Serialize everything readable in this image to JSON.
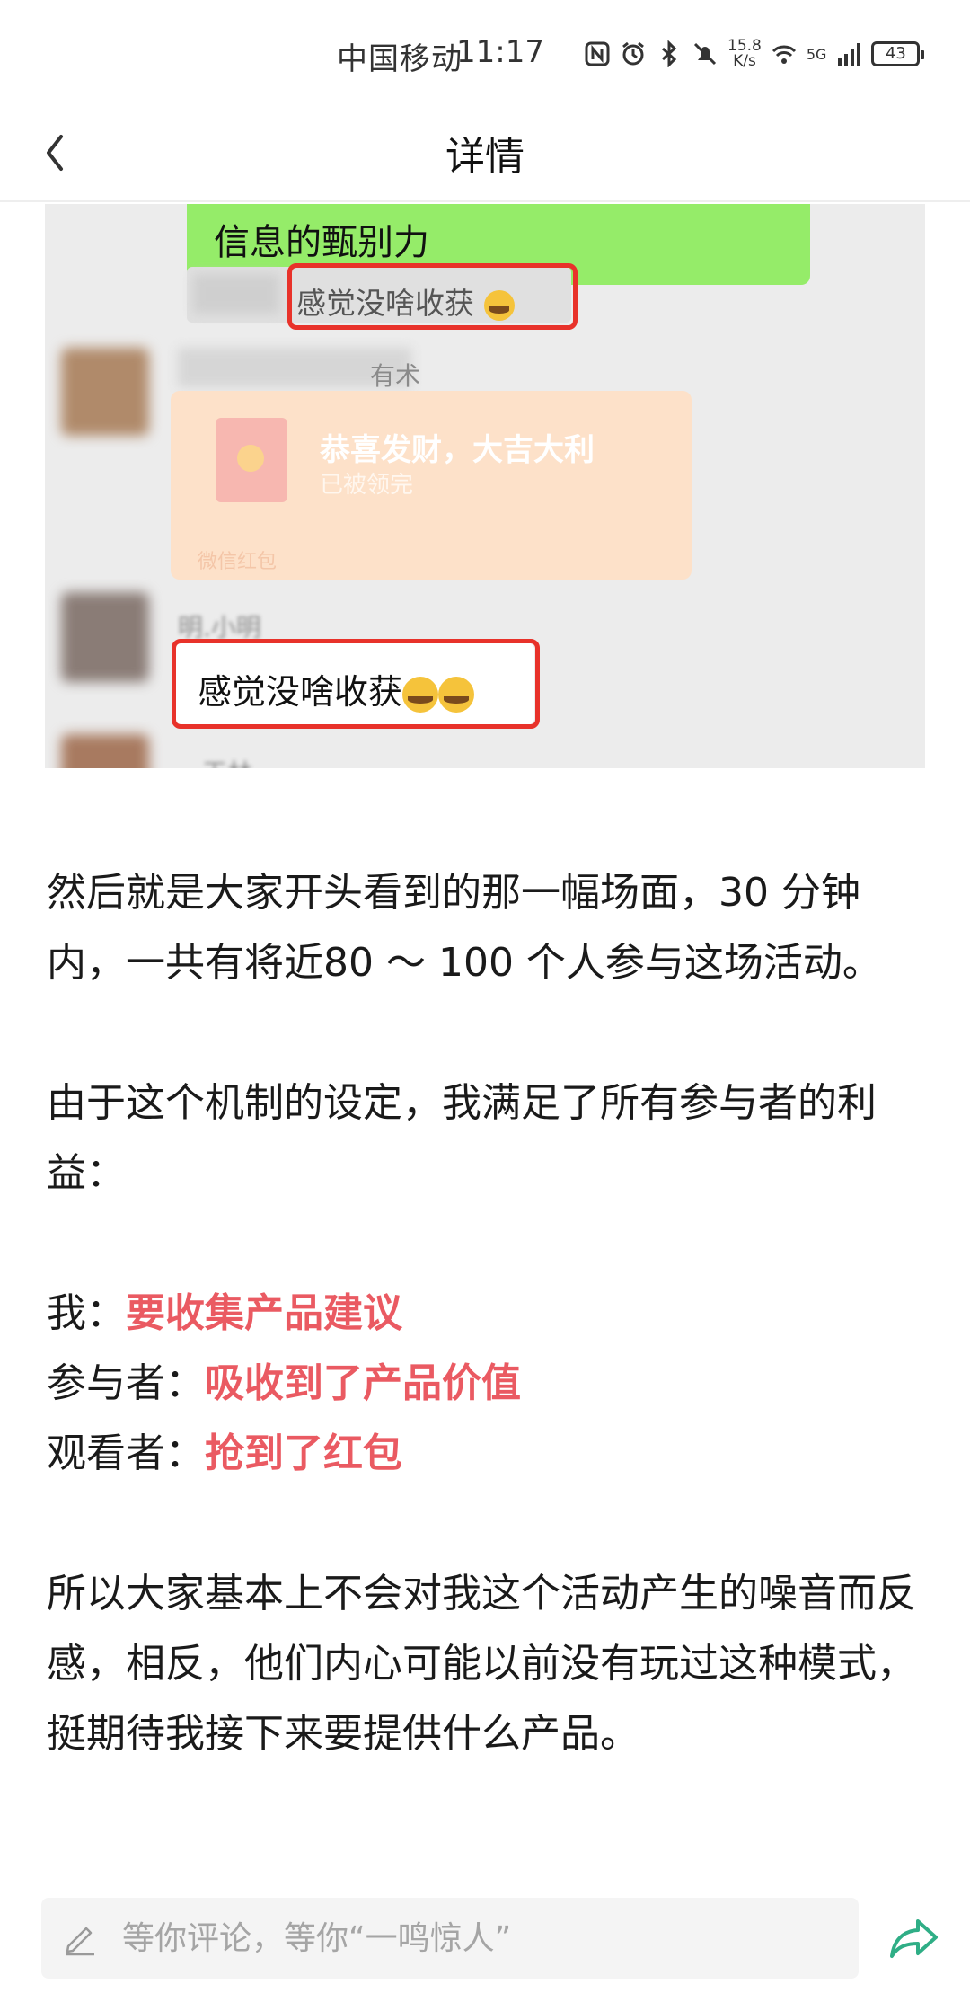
{
  "status_bar": {
    "carrier": "中国移动",
    "time": "11:17",
    "speed_value": "15.8",
    "speed_unit": "K/s",
    "network": "5G",
    "battery": "43"
  },
  "header": {
    "title": "详情"
  },
  "chat_image": {
    "green_bubble_text": "信息的甄别力",
    "quote_text": "感觉没啥收获",
    "name_1": "有术",
    "red_packet_title": "恭喜发财，大吉大利",
    "red_packet_status": "已被领完",
    "red_packet_footer": "微信红包",
    "name_2": "明.小明",
    "reply_text": "感觉没啥收获",
    "name_3": "王林"
  },
  "article": {
    "p1": "然后就是大家开头看到的那一幅场面，30 分钟内，一共有将近80 ～ 100 个人参与这场活动。",
    "p2": "由于这个机制的设定，我满足了所有参与者的利益：",
    "benefits": [
      {
        "label": "我：",
        "value": "要收集产品建议"
      },
      {
        "label": "参与者：",
        "value": "吸收到了产品价值"
      },
      {
        "label": "观看者：",
        "value": "抢到了红包"
      }
    ],
    "p3": "所以大家基本上不会对我这个活动产生的噪音而反感，相反，他们内心可能以前没有玩过这种模式，挺期待我接下来要提供什么产品。"
  },
  "comment": {
    "placeholder": "等你评论，等你“一鸣惊人”"
  },
  "colors": {
    "highlight": "#ea5a62",
    "wechat_green": "#95ec69",
    "red_box": "#e8322a",
    "share_green": "#2fae86"
  }
}
